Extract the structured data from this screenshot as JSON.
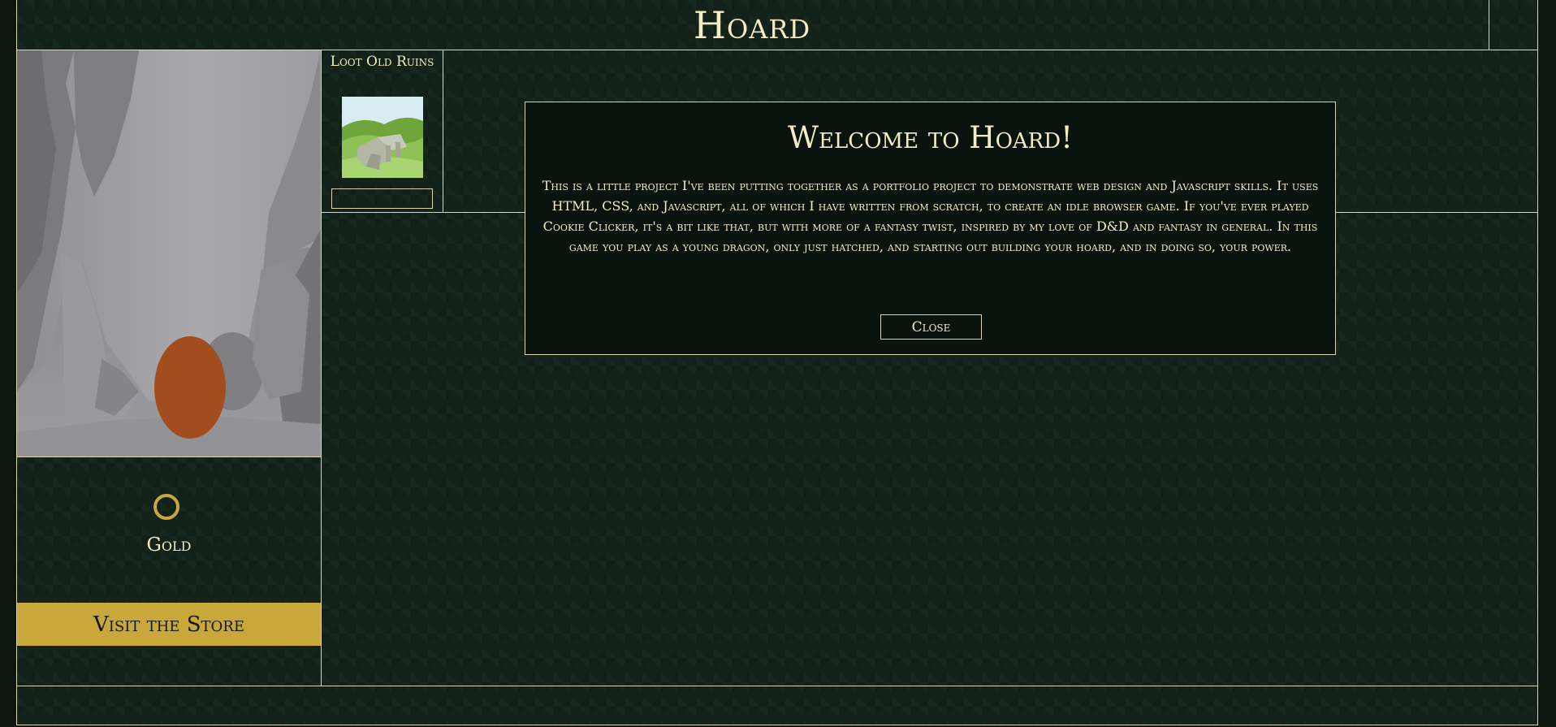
{
  "header": {
    "title": "Hoard"
  },
  "gold": {
    "label": "Gold",
    "icon": "gold-coin-icon",
    "color": "#c9a73a"
  },
  "store": {
    "label": "Visit the Store"
  },
  "locations": [
    {
      "name": "Loot Old Ruins",
      "icon": "old-ruins-image",
      "progress": 0
    }
  ],
  "modal": {
    "title": "Welcome to Hoard!",
    "body": "This is a little project I've been putting together as a portfolio project to demonstrate web design and Javascript skills. It uses HTML, CSS, and Javascript, all of which I have written from scratch, to create an idle browser game. If you've ever played Cookie Clicker, it's a bit like that, but with more of a fantasy twist, inspired by my love of D&D and fantasy in general. In this game you play as a young dragon, only just hatched, and starting out building your hoard, and in doing so, your power.",
    "close_label": "Close"
  },
  "colors": {
    "background": "#13231a",
    "text": "#f3ecc4",
    "accent_gold": "#c9a73a",
    "border": "#d9d4b4",
    "egg": "#a34d1e"
  }
}
